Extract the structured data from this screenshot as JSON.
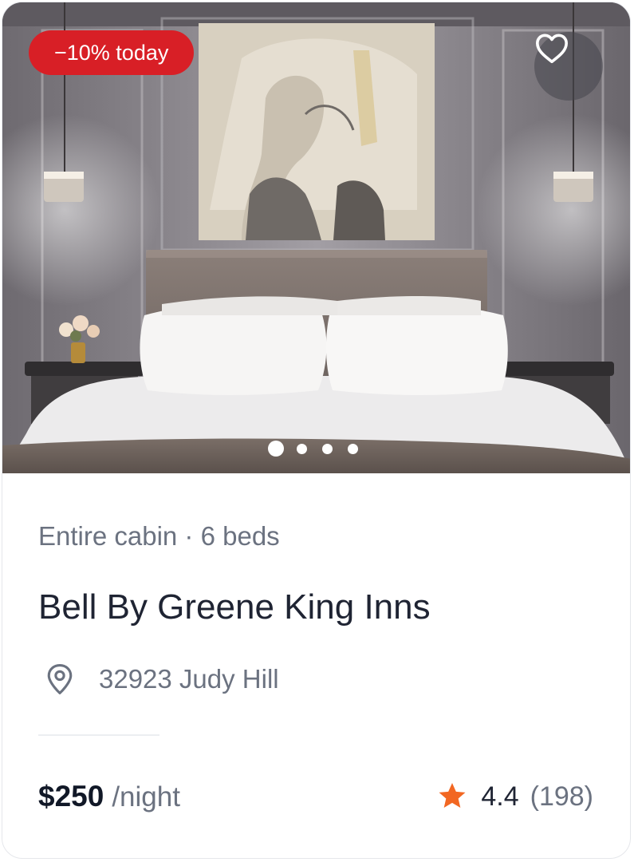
{
  "listing": {
    "discount_badge": "−10% today",
    "image_alt": "Hotel bedroom with white bedding, tufted headboard, pendant lamps and portrait painting",
    "gallery": {
      "count": 4,
      "active_index": 0
    },
    "category": "Entire cabin · 6 beds",
    "name": "Bell By Greene King Inns",
    "address": "32923 Judy Hill",
    "price": "$250",
    "price_unit": "/night",
    "rating": "4.4",
    "reviews": "(198)"
  },
  "icons": {
    "favorite": "heart-outline-icon",
    "location": "map-pin-icon",
    "rating": "star-icon"
  },
  "colors": {
    "badge_bg": "#d81f26",
    "star": "#f26722",
    "title": "#1f2433",
    "muted": "#6b7280"
  }
}
